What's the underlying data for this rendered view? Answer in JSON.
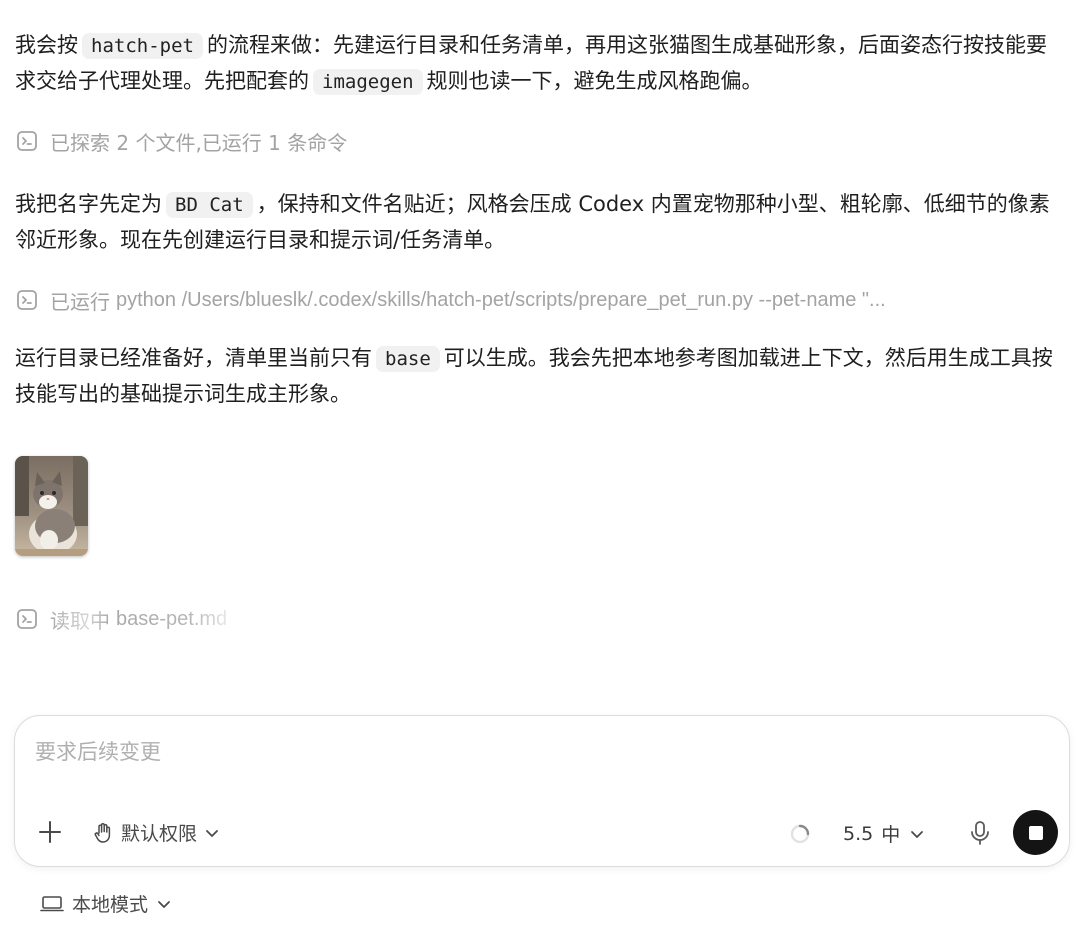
{
  "messages": {
    "p1": {
      "t1": "我会按",
      "c1": "hatch-pet",
      "t2": "的流程来做：先建运行目录和任务清单，再用这张猫图生成基础形象，后面姿态行按技能要求交给子代理处理。先把配套的",
      "c2": "imagegen",
      "t3": "规则也读一下，避免生成风格跑偏。"
    },
    "status1": {
      "verb": "已探索 2 个文件,已运行 1 条命令",
      "icon": "terminal-icon"
    },
    "p2": {
      "t1": "我把名字先定为",
      "c1": "BD Cat",
      "t2": "，保持和文件名贴近；风格会压成 Codex 内置宠物那种小型、粗轮廓、低细节的像素邻近形象。现在先创建运行目录和提示词/任务清单。"
    },
    "status2": {
      "verb": "已运行",
      "cmd": "python /Users/blueslk/.codex/skills/hatch-pet/scripts/prepare_pet_run.py --pet-name \"...",
      "icon": "terminal-icon"
    },
    "p3": {
      "t1": "运行目录已经准备好，清单里当前只有",
      "c1": "base",
      "t2": "可以生成。我会先把本地参考图加载进上下文，然后用生成工具按技能写出的基础提示词生成主形象。"
    },
    "attachment": {
      "kind": "reference-cat-photo"
    },
    "status3": {
      "verb": "读取中",
      "cmd": "base-pet.md",
      "icon": "terminal-icon"
    }
  },
  "composer": {
    "placeholder": "要求后续变更",
    "permission_label": "默认权限",
    "model_label": "5.5",
    "effort_label": "中"
  },
  "footer": {
    "mode_label": "本地模式"
  },
  "colors": {
    "stop_button": "#141414",
    "code_bg": "#f1f1f1",
    "muted": "#a3a3a3"
  }
}
